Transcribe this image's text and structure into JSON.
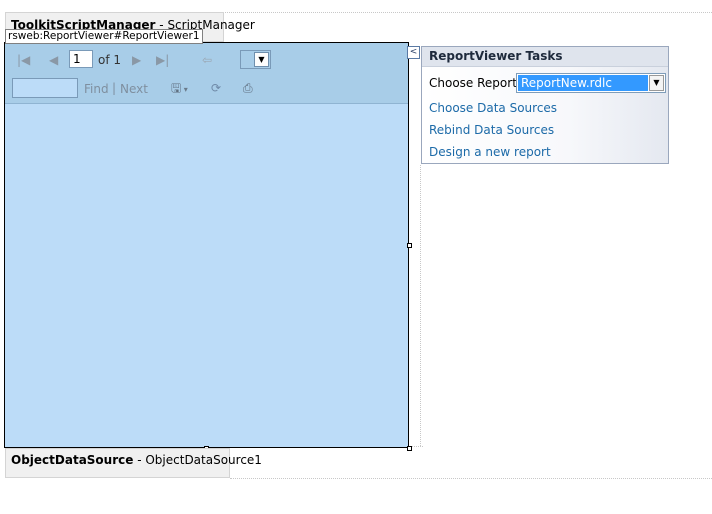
{
  "script_manager": {
    "type_name": "ToolkitScriptManager",
    "separator": " - ",
    "instance_name": "ScriptManager"
  },
  "selection_tag": "rsweb:ReportViewer#ReportViewer1",
  "report_viewer": {
    "toolbar": {
      "first_page_icon": "first-page-icon",
      "prev_page_icon": "previous-page-icon",
      "page_number": "1",
      "page_count_label": "of 1",
      "next_page_icon": "next-page-icon",
      "last_page_icon": "last-page-icon",
      "back_icon": "back-icon",
      "zoom_value": "",
      "find_value": "",
      "find_label": "Find",
      "find_separator": "|",
      "next_label": "Next",
      "export_icon": "save-export-icon",
      "refresh_icon": "refresh-icon",
      "print_icon": "printer-icon"
    },
    "body_color": "#bcdcf8",
    "toolbar_color": "#a8cde8"
  },
  "tasks_panel": {
    "title": "ReportViewer Tasks",
    "choose_report_label": "Choose Report",
    "choose_report_value": "ReportNew.rdlc",
    "links": [
      "Choose Data Sources",
      "Rebind Data Sources",
      "Design a new report"
    ],
    "link_color": "#1c6aa8"
  },
  "object_data_source": {
    "type_name": "ObjectDataSource",
    "separator": " - ",
    "instance_name": "ObjectDataSource1"
  }
}
